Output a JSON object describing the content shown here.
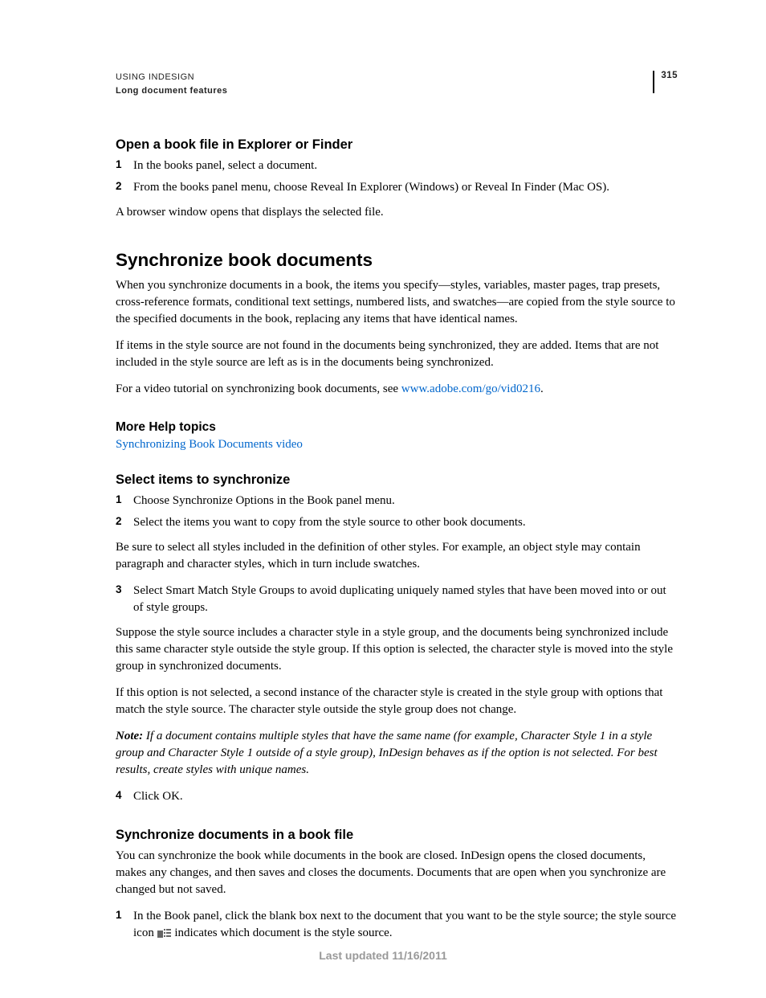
{
  "header": {
    "title": "USING INDESIGN",
    "subtitle": "Long document features",
    "page_number": "315"
  },
  "s1": {
    "heading": "Open a book file in Explorer or Finder",
    "step1": "In the books panel, select a document.",
    "step2": "From the books panel menu, choose Reveal In Explorer (Windows) or Reveal In Finder (Mac OS).",
    "after": "A browser window opens that displays the selected file."
  },
  "s2": {
    "heading": "Synchronize book documents",
    "p1": "When you synchronize documents in a book, the items you specify—styles, variables, master pages, trap presets, cross-reference formats, conditional text settings, numbered lists, and swatches—are copied from the style source to the specified documents in the book, replacing any items that have identical names.",
    "p2": "If items in the style source are not found in the documents being synchronized, they are added. Items that are not included in the style source are left as is in the documents being synchronized.",
    "p3_pre": "For a video tutorial on synchronizing book documents, see ",
    "p3_link": "www.adobe.com/go/vid0216",
    "p3_post": "."
  },
  "help": {
    "heading": "More Help topics",
    "link": "Synchronizing Book Documents video"
  },
  "s3": {
    "heading": "Select items to synchronize",
    "step1": "Choose Synchronize Options in the Book panel menu.",
    "step2": "Select the items you want to copy from the style source to other book documents.",
    "p_after2": "Be sure to select all styles included in the definition of other styles. For example, an object style may contain paragraph and character styles, which in turn include swatches.",
    "step3": "Select Smart Match Style Groups to avoid duplicating uniquely named styles that have been moved into or out of style groups.",
    "p_after3a": "Suppose the style source includes a character style in a style group, and the documents being synchronized include this same character style outside the style group. If this option is selected, the character style is moved into the style group in synchronized documents.",
    "p_after3b": "If this option is not selected, a second instance of the character style is created in the style group with options that match the style source. The character style outside the style group does not change.",
    "note_label": "Note:",
    "note_body": " If a document contains multiple styles that have the same name (for example, Character Style 1 in a style group and Character Style 1 outside of a style group), InDesign behaves as if the option is not selected. For best results, create styles with unique names.",
    "step4": "Click OK."
  },
  "s4": {
    "heading": "Synchronize documents in a book file",
    "p1": "You can synchronize the book while documents in the book are closed. InDesign opens the closed documents, makes any changes, and then saves and closes the documents. Documents that are open when you synchronize are changed but not saved.",
    "step1_pre": "In the Book panel, click the blank box next to the document that you want to be the style source; the style source icon ",
    "step1_post": " indicates which document is the style source."
  },
  "footer": {
    "updated": "Last updated 11/16/2011"
  }
}
